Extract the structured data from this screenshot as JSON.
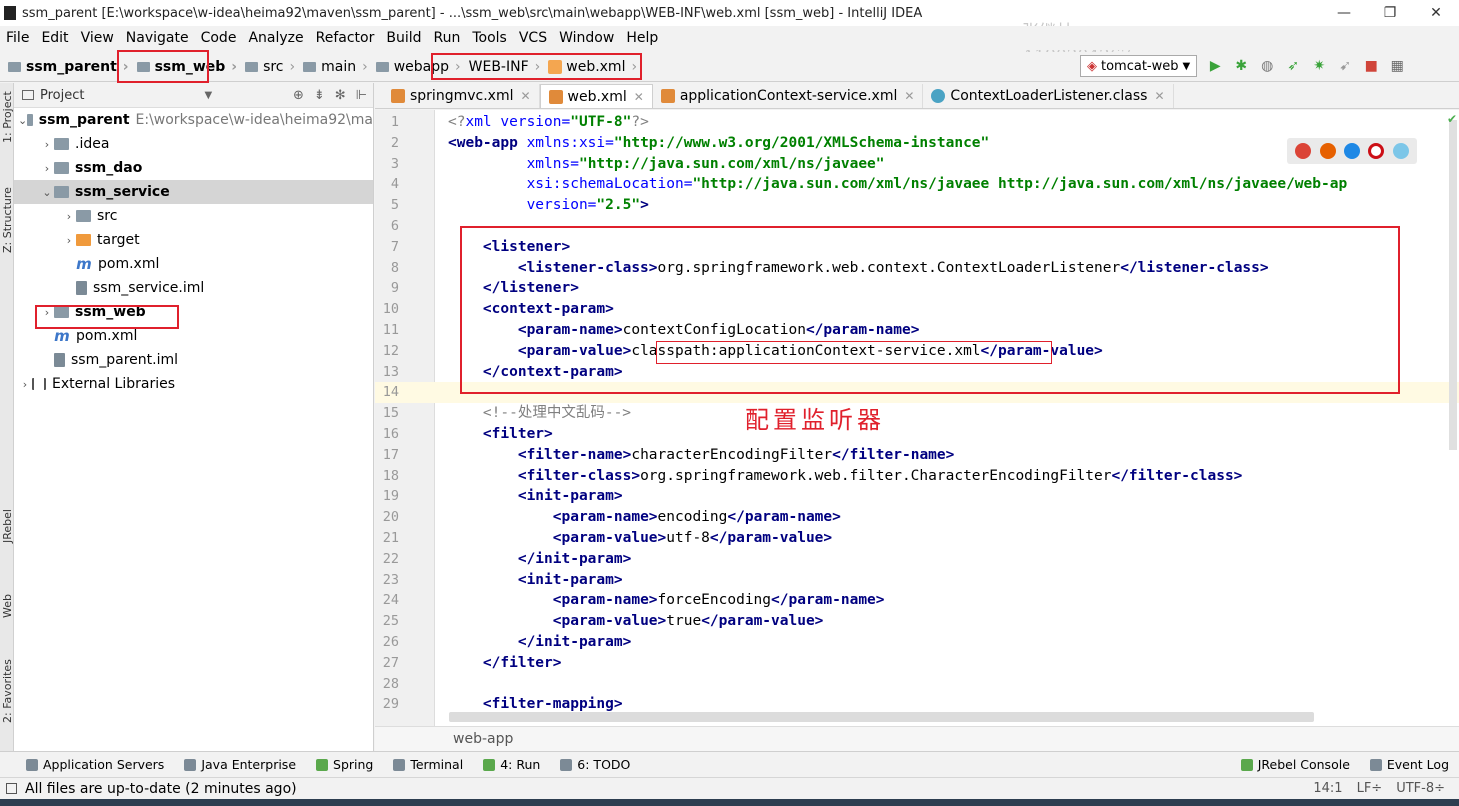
{
  "window": {
    "title": "ssm_parent [E:\\workspace\\w-idea\\heima92\\maven\\ssm_parent] - ...\\ssm_web\\src\\main\\webapp\\WEB-INF\\web.xml [ssm_web] - IntelliJ IDEA",
    "minimize": "—",
    "maximize": "❐",
    "close": "✕",
    "watermark_name": "张继林",
    "watermark_id": "A190204267"
  },
  "menu": [
    "File",
    "Edit",
    "View",
    "Navigate",
    "Code",
    "Analyze",
    "Refactor",
    "Build",
    "Run",
    "Tools",
    "VCS",
    "Window",
    "Help"
  ],
  "breadcrumbs": [
    "ssm_parent",
    "ssm_web",
    "src",
    "main",
    "webapp",
    "WEB-INF",
    "web.xml"
  ],
  "run_config": "tomcat-web",
  "project_panel": {
    "title": "Project",
    "tree": [
      {
        "label": "ssm_parent",
        "path": "E:\\workspace\\w-idea\\heima92\\ma",
        "bold": true,
        "arrow": "⌄",
        "indent": 0,
        "icon": "module"
      },
      {
        "label": ".idea",
        "arrow": "›",
        "indent": 1,
        "icon": "folder"
      },
      {
        "label": "ssm_dao",
        "bold": true,
        "arrow": "›",
        "indent": 1,
        "icon": "module"
      },
      {
        "label": "ssm_service",
        "bold": true,
        "arrow": "⌄",
        "indent": 1,
        "icon": "module",
        "selected": true
      },
      {
        "label": "src",
        "arrow": "›",
        "indent": 2,
        "icon": "folder"
      },
      {
        "label": "target",
        "arrow": "›",
        "indent": 2,
        "icon": "orange"
      },
      {
        "label": "pom.xml",
        "indent": 2,
        "icon": "pom"
      },
      {
        "label": "ssm_service.iml",
        "indent": 2,
        "icon": "iml"
      },
      {
        "label": "ssm_web",
        "bold": true,
        "arrow": "›",
        "indent": 1,
        "icon": "module"
      },
      {
        "label": "pom.xml",
        "indent": 1,
        "icon": "pom"
      },
      {
        "label": "ssm_parent.iml",
        "indent": 1,
        "icon": "iml"
      },
      {
        "label": "External Libraries",
        "arrow": "›",
        "indent": 0,
        "icon": "lib"
      }
    ]
  },
  "left_strip": [
    "1: Project",
    "Z: Structure",
    "JRebel",
    "Web",
    "2: Favorites"
  ],
  "editor_tabs": [
    {
      "label": "springmvc.xml",
      "icon": "xml"
    },
    {
      "label": "web.xml",
      "icon": "xml",
      "active": true
    },
    {
      "label": "applicationContext-service.xml",
      "icon": "xml"
    },
    {
      "label": "ContextLoaderListener.class",
      "icon": "class"
    }
  ],
  "code_lines": [
    [
      [
        "cmt",
        "<?"
      ],
      [
        "attr",
        "xml version="
      ],
      [
        "val",
        "\"UTF-8\""
      ],
      [
        "cmt",
        "?>"
      ]
    ],
    [
      [
        "tag",
        "<web-app "
      ],
      [
        "attr",
        "xmlns:xsi="
      ],
      [
        "val",
        "\"http://www.w3.org/2001/XMLSchema-instance\""
      ]
    ],
    [
      [
        "txt",
        "         "
      ],
      [
        "attr",
        "xmlns="
      ],
      [
        "val",
        "\"http://java.sun.com/xml/ns/javaee\""
      ]
    ],
    [
      [
        "txt",
        "         "
      ],
      [
        "attr",
        "xsi:schemaLocation="
      ],
      [
        "val",
        "\"http://java.sun.com/xml/ns/javaee http://java.sun.com/xml/ns/javaee/web-ap"
      ]
    ],
    [
      [
        "txt",
        "         "
      ],
      [
        "attr",
        "version="
      ],
      [
        "val",
        "\"2.5\""
      ],
      [
        "tag",
        ">"
      ]
    ],
    [],
    [
      [
        "txt",
        "    "
      ],
      [
        "tag",
        "<listener>"
      ]
    ],
    [
      [
        "txt",
        "        "
      ],
      [
        "tag",
        "<listener-class>"
      ],
      [
        "txt",
        "org.springframework.web.context.ContextLoaderListener"
      ],
      [
        "tag",
        "</listener-class>"
      ]
    ],
    [
      [
        "txt",
        "    "
      ],
      [
        "tag",
        "</listener>"
      ]
    ],
    [
      [
        "txt",
        "    "
      ],
      [
        "tag",
        "<context-param>"
      ]
    ],
    [
      [
        "txt",
        "        "
      ],
      [
        "tag",
        "<param-name>"
      ],
      [
        "txt",
        "contextConfigLocation"
      ],
      [
        "tag",
        "</param-name>"
      ]
    ],
    [
      [
        "txt",
        "        "
      ],
      [
        "tag",
        "<param-value>"
      ],
      [
        "txt",
        "classpath:applicationContext-service.xml"
      ],
      [
        "tag",
        "</param-value>"
      ]
    ],
    [
      [
        "txt",
        "    "
      ],
      [
        "tag",
        "</context-param>"
      ]
    ],
    [],
    [
      [
        "txt",
        "    "
      ],
      [
        "cmt",
        "<!--处理中文乱码-->"
      ]
    ],
    [
      [
        "txt",
        "    "
      ],
      [
        "tag",
        "<filter>"
      ]
    ],
    [
      [
        "txt",
        "        "
      ],
      [
        "tag",
        "<filter-name>"
      ],
      [
        "txt",
        "characterEncodingFilter"
      ],
      [
        "tag",
        "</filter-name>"
      ]
    ],
    [
      [
        "txt",
        "        "
      ],
      [
        "tag",
        "<filter-class>"
      ],
      [
        "txt",
        "org.springframework.web.filter.CharacterEncodingFilter"
      ],
      [
        "tag",
        "</filter-class>"
      ]
    ],
    [
      [
        "txt",
        "        "
      ],
      [
        "tag",
        "<init-param>"
      ]
    ],
    [
      [
        "txt",
        "            "
      ],
      [
        "tag",
        "<param-name>"
      ],
      [
        "txt",
        "encoding"
      ],
      [
        "tag",
        "</param-name>"
      ]
    ],
    [
      [
        "txt",
        "            "
      ],
      [
        "tag",
        "<param-value>"
      ],
      [
        "txt",
        "utf-8"
      ],
      [
        "tag",
        "</param-value>"
      ]
    ],
    [
      [
        "txt",
        "        "
      ],
      [
        "tag",
        "</init-param>"
      ]
    ],
    [
      [
        "txt",
        "        "
      ],
      [
        "tag",
        "<init-param>"
      ]
    ],
    [
      [
        "txt",
        "            "
      ],
      [
        "tag",
        "<param-name>"
      ],
      [
        "txt",
        "forceEncoding"
      ],
      [
        "tag",
        "</param-name>"
      ]
    ],
    [
      [
        "txt",
        "            "
      ],
      [
        "tag",
        "<param-value>"
      ],
      [
        "txt",
        "true"
      ],
      [
        "tag",
        "</param-value>"
      ]
    ],
    [
      [
        "txt",
        "        "
      ],
      [
        "tag",
        "</init-param>"
      ]
    ],
    [
      [
        "txt",
        "    "
      ],
      [
        "tag",
        "</filter>"
      ]
    ],
    [],
    [
      [
        "txt",
        "    "
      ],
      [
        "tag",
        "<filter-mapping>"
      ]
    ]
  ],
  "annotation": "配置监听器",
  "editor_breadcrumb": "web-app",
  "tool_windows": [
    {
      "label": "Application Servers",
      "icon": "gray"
    },
    {
      "label": "Java Enterprise",
      "icon": "gray"
    },
    {
      "label": "Spring",
      "icon": "green"
    },
    {
      "label": "Terminal",
      "icon": "gray"
    },
    {
      "label": "4: Run",
      "icon": "green"
    },
    {
      "label": "6: TODO",
      "icon": "gray"
    },
    {
      "label": "JRebel Console",
      "icon": "green"
    },
    {
      "label": "Event Log",
      "icon": "gray"
    }
  ],
  "status": {
    "message": "All files are up-to-date (2 minutes ago)",
    "position": "14:1",
    "line_sep": "LF÷",
    "encoding": "UTF-8÷"
  },
  "colors": {
    "tag": "#000080",
    "attr": "#0000ff",
    "value": "#008000",
    "highlight": "#e0202c"
  }
}
